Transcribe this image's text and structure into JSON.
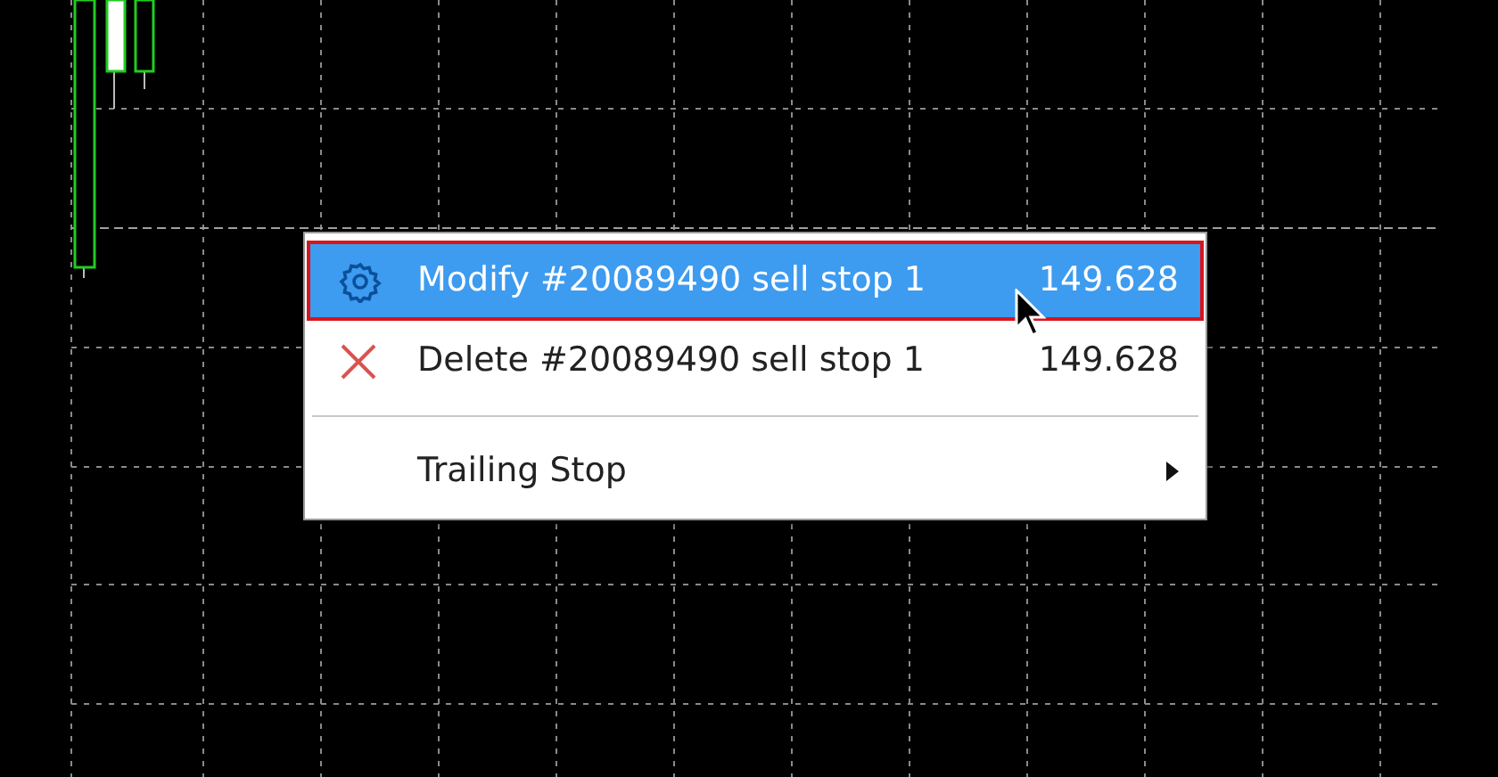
{
  "context_menu": {
    "items": [
      {
        "kind": "modify",
        "label": "Modify #20089490 sell stop 1",
        "value": "149.628",
        "selected": true
      },
      {
        "kind": "delete",
        "label": "Delete #20089490 sell stop 1",
        "value": "149.628",
        "selected": false
      },
      {
        "kind": "separator"
      },
      {
        "kind": "submenu",
        "label": "Trailing Stop",
        "selected": false
      }
    ]
  }
}
